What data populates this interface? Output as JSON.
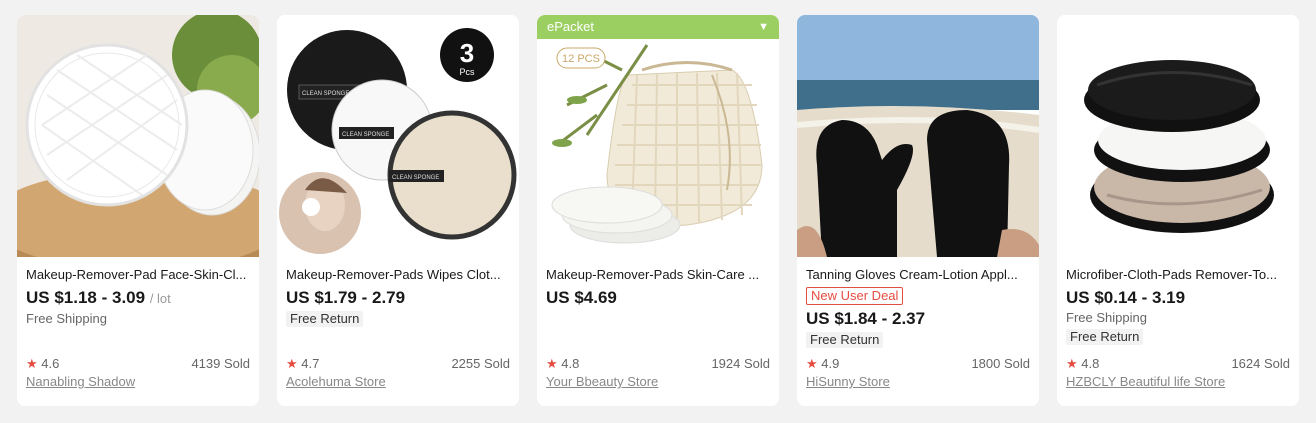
{
  "products": [
    {
      "title": "Makeup-Remover-Pad Face-Skin-Cl...",
      "price": "US $1.18 - 3.09",
      "unit": "/ lot",
      "shipping": "Free Shipping",
      "rating": "4.6",
      "sold": "4139 Sold",
      "store": "Nanabling Shadow"
    },
    {
      "title": "Makeup-Remover-Pads Wipes Clot...",
      "price": "US $1.79 - 2.79",
      "return": "Free Return",
      "rating": "4.7",
      "sold": "2255 Sold",
      "store": "Acolehuma Store",
      "image_badge": "3",
      "image_badge_sub": "Pcs",
      "pad_label": "CLEAN SPONGE"
    },
    {
      "tag": "ePacket",
      "title": "Makeup-Remover-Pads Skin-Care ...",
      "price": "US $4.69",
      "rating": "4.8",
      "sold": "1924 Sold",
      "store": "Your Bbeauty Store",
      "image_badge": "12 PCS"
    },
    {
      "title": "Tanning Gloves Cream-Lotion Appl...",
      "deal": "New User Deal",
      "price": "US $1.84 - 2.37",
      "return": "Free Return",
      "rating": "4.9",
      "sold": "1800 Sold",
      "store": "HiSunny Store"
    },
    {
      "title": "Microfiber-Cloth-Pads Remover-To...",
      "price": "US $0.14 - 3.19",
      "shipping": "Free Shipping",
      "return": "Free Return",
      "rating": "4.8",
      "sold": "1624 Sold",
      "store": "HZBCLY Beautiful life Store"
    }
  ],
  "icons": {
    "star": "star-icon",
    "chevron": "chevron-down-icon"
  },
  "colors": {
    "accent": "#e54d42",
    "epacket": "#9ccf62",
    "background": "#f2f2f2"
  }
}
